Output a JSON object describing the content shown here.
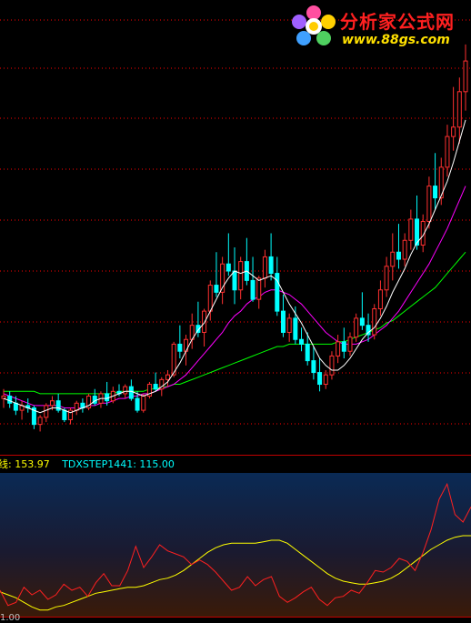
{
  "watermark": {
    "title": "分析家公式网",
    "url": "www.88gs.com"
  },
  "indicator_labels": {
    "line1": "线: 153.97",
    "line2": "TDXSTEP1441: 115.00"
  },
  "bottom_axis": {
    "label": "1.00"
  },
  "colors": {
    "background": "#000000",
    "up_candle": "#ff3030",
    "down_candle": "#00ffff",
    "ma_fast": "#ffffff",
    "ma_mid": "#ffff00",
    "ma_slow": "#ff00ff",
    "ma_long": "#00ff00",
    "grid": "#ff0000",
    "indicator_red": "#ff2020",
    "indicator_yellow": "#ffff00"
  },
  "chart_data": [
    {
      "type": "candlestick",
      "candles": [
        [
          10,
          14,
          6,
          11
        ],
        [
          11,
          13,
          6,
          8
        ],
        [
          8,
          11,
          3,
          5
        ],
        [
          5,
          9,
          1,
          7
        ],
        [
          7,
          10,
          4,
          6
        ],
        [
          6,
          7,
          -3,
          -1
        ],
        [
          -1,
          3,
          -4,
          2
        ],
        [
          2,
          8,
          0,
          7
        ],
        [
          7,
          11,
          5,
          9
        ],
        [
          9,
          12,
          4,
          5
        ],
        [
          5,
          6,
          0,
          1
        ],
        [
          1,
          6,
          -1,
          5
        ],
        [
          5,
          9,
          3,
          8
        ],
        [
          8,
          10,
          4,
          6
        ],
        [
          6,
          12,
          5,
          11
        ],
        [
          11,
          14,
          7,
          8
        ],
        [
          8,
          13,
          6,
          12
        ],
        [
          12,
          17,
          7,
          9
        ],
        [
          9,
          15,
          8,
          13
        ],
        [
          13,
          16,
          11,
          12
        ],
        [
          12,
          16,
          10,
          15
        ],
        [
          15,
          18,
          9,
          10
        ],
        [
          10,
          13,
          4,
          5
        ],
        [
          5,
          12,
          4,
          11
        ],
        [
          11,
          17,
          10,
          16
        ],
        [
          16,
          21,
          13,
          14
        ],
        [
          14,
          19,
          11,
          18
        ],
        [
          18,
          22,
          15,
          20
        ],
        [
          20,
          34,
          19,
          33
        ],
        [
          33,
          41,
          27,
          30
        ],
        [
          30,
          37,
          24,
          35
        ],
        [
          35,
          46,
          31,
          41
        ],
        [
          41,
          51,
          36,
          38
        ],
        [
          38,
          48,
          32,
          47
        ],
        [
          47,
          60,
          43,
          58
        ],
        [
          58,
          72,
          53,
          55
        ],
        [
          55,
          70,
          50,
          67
        ],
        [
          67,
          80,
          62,
          64
        ],
        [
          64,
          74,
          50,
          56
        ],
        [
          56,
          70,
          52,
          68
        ],
        [
          68,
          78,
          58,
          60
        ],
        [
          60,
          70,
          51,
          52
        ],
        [
          52,
          62,
          48,
          61
        ],
        [
          61,
          73,
          57,
          70
        ],
        [
          70,
          80,
          60,
          63
        ],
        [
          63,
          70,
          45,
          47
        ],
        [
          47,
          54,
          36,
          38
        ],
        [
          38,
          46,
          34,
          44
        ],
        [
          44,
          49,
          33,
          35
        ],
        [
          35,
          40,
          30,
          33
        ],
        [
          33,
          38,
          24,
          26
        ],
        [
          26,
          32,
          18,
          21
        ],
        [
          21,
          27,
          13,
          16
        ],
        [
          16,
          22,
          14,
          20
        ],
        [
          20,
          30,
          18,
          28
        ],
        [
          28,
          37,
          25,
          34
        ],
        [
          34,
          40,
          27,
          30
        ],
        [
          30,
          38,
          28,
          36
        ],
        [
          36,
          46,
          34,
          44
        ],
        [
          44,
          55,
          39,
          41
        ],
        [
          41,
          46,
          34,
          37
        ],
        [
          37,
          50,
          35,
          48
        ],
        [
          48,
          60,
          45,
          56
        ],
        [
          56,
          70,
          53,
          66
        ],
        [
          66,
          80,
          60,
          72
        ],
        [
          72,
          84,
          65,
          69
        ],
        [
          69,
          80,
          66,
          77
        ],
        [
          77,
          90,
          73,
          86
        ],
        [
          86,
          96,
          73,
          75
        ],
        [
          75,
          88,
          72,
          85
        ],
        [
          85,
          104,
          82,
          100
        ],
        [
          100,
          114,
          90,
          95
        ],
        [
          95,
          112,
          92,
          108
        ],
        [
          108,
          126,
          104,
          121
        ],
        [
          121,
          142,
          115,
          125
        ],
        [
          125,
          146,
          118,
          140
        ],
        [
          140,
          160,
          132,
          153
        ]
      ],
      "ma_fast": [
        10,
        9,
        8,
        7,
        6,
        5,
        4,
        5,
        6,
        6,
        5,
        4,
        5,
        6,
        7,
        9,
        10,
        10,
        11,
        12,
        13,
        13,
        12,
        11,
        12,
        13,
        15,
        17,
        21,
        25,
        30,
        35,
        39,
        42,
        47,
        52,
        57,
        61,
        64,
        63,
        64,
        62,
        60,
        61,
        62,
        60,
        55,
        50,
        46,
        42,
        37,
        32,
        27,
        24,
        22,
        22,
        24,
        27,
        31,
        35,
        38,
        40,
        44,
        49,
        55,
        60,
        65,
        71,
        76,
        79,
        84,
        90,
        96,
        102,
        110,
        119,
        128
      ],
      "ma_slow": [
        12,
        11,
        10,
        9,
        8,
        7,
        7,
        7,
        7,
        7,
        6,
        6,
        6,
        6,
        7,
        7,
        8,
        8,
        9,
        10,
        10,
        11,
        11,
        12,
        12,
        13,
        14,
        15,
        16,
        18,
        20,
        23,
        26,
        29,
        32,
        35,
        38,
        42,
        45,
        47,
        50,
        52,
        53,
        55,
        56,
        56,
        55,
        54,
        52,
        50,
        47,
        44,
        41,
        38,
        36,
        34,
        33,
        33,
        33,
        34,
        35,
        37,
        39,
        41,
        44,
        47,
        51,
        55,
        59,
        63,
        67,
        72,
        77,
        82,
        88,
        94,
        100
      ],
      "ma_long": [
        13,
        13,
        13,
        13,
        13,
        13,
        12,
        12,
        12,
        12,
        12,
        12,
        12,
        12,
        12,
        12,
        12,
        12,
        12,
        13,
        13,
        13,
        13,
        13,
        14,
        14,
        15,
        15,
        16,
        16,
        17,
        18,
        19,
        20,
        21,
        22,
        23,
        24,
        25,
        26,
        27,
        28,
        29,
        30,
        31,
        32,
        32,
        33,
        33,
        33,
        33,
        33,
        33,
        33,
        33,
        34,
        34,
        35,
        36,
        37,
        38,
        39,
        40,
        42,
        43,
        45,
        47,
        49,
        51,
        53,
        55,
        57,
        60,
        63,
        66,
        69,
        72
      ],
      "ylim": [
        -10,
        175
      ]
    },
    {
      "type": "line",
      "series": [
        {
          "name": "",
          "values": [
            28,
            24,
            20,
            14,
            8,
            4,
            4,
            8,
            10,
            14,
            18,
            22,
            26,
            28,
            30,
            32,
            34,
            34,
            36,
            40,
            44,
            46,
            50,
            56,
            64,
            72,
            80,
            86,
            90,
            92,
            92,
            92,
            92,
            94,
            96,
            96,
            92,
            84,
            76,
            68,
            60,
            52,
            46,
            42,
            40,
            38,
            38,
            40,
            42,
            46,
            52,
            60,
            68,
            76,
            84,
            90,
            96,
            100,
            102,
            102
          ]
        },
        {
          "name": "",
          "values": [
            30,
            10,
            14,
            34,
            24,
            30,
            18,
            24,
            38,
            30,
            34,
            22,
            40,
            52,
            36,
            36,
            56,
            88,
            60,
            74,
            90,
            82,
            78,
            74,
            64,
            70,
            64,
            54,
            42,
            30,
            34,
            48,
            36,
            44,
            48,
            22,
            14,
            20,
            28,
            34,
            18,
            10,
            20,
            22,
            30,
            26,
            40,
            56,
            54,
            60,
            72,
            68,
            56,
            80,
            110,
            150,
            170,
            130,
            120,
            140
          ]
        }
      ],
      "ylim": [
        0,
        180
      ]
    }
  ]
}
